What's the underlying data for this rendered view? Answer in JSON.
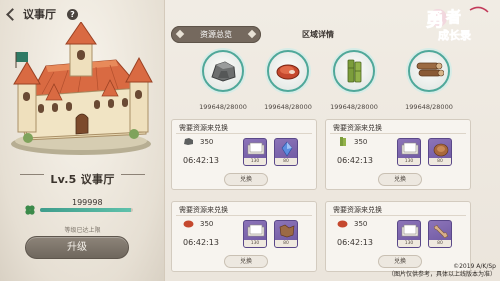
{
  "header": {
    "title": "议事厅"
  },
  "left_panel": {
    "level_label": "Lv.5 议事厅",
    "exp_value": "199998",
    "exp_fraction": 0.98,
    "max_note": "等级已达上限",
    "upgrade_label": "升级"
  },
  "tabs": {
    "overview": "资源总览",
    "detail": "区域详情"
  },
  "logo": {
    "text": "勇者成长录"
  },
  "resources": [
    {
      "name": "stone",
      "count": "199648/28000"
    },
    {
      "name": "meat",
      "count": "199648/28000"
    },
    {
      "name": "bamboo",
      "count": "199648/28000"
    },
    {
      "name": "wood",
      "count": "199648/28000"
    }
  ],
  "cards": [
    {
      "title": "需要资源来兑换",
      "resource_icon": "stone-icon",
      "amount": "350",
      "timer": "06:42:13",
      "slots": [
        {
          "icon": "paper-icon",
          "num": "130"
        },
        {
          "icon": "crystal-icon",
          "num": "80"
        }
      ],
      "button": "兑换"
    },
    {
      "title": "需要资源来兑换",
      "resource_icon": "bamboo-icon",
      "amount": "350",
      "timer": "06:42:13",
      "slots": [
        {
          "icon": "paper-icon",
          "num": "130"
        },
        {
          "icon": "leather-icon",
          "num": "80"
        }
      ],
      "button": "兑换"
    },
    {
      "title": "需要资源来兑换",
      "resource_icon": "meat-icon",
      "amount": "350",
      "timer": "06:42:13",
      "slots": [
        {
          "icon": "paper-icon",
          "num": "130"
        },
        {
          "icon": "hide-icon",
          "num": "80"
        }
      ],
      "button": "兑换"
    },
    {
      "title": "需要资源来兑换",
      "resource_icon": "meat-icon",
      "amount": "350",
      "timer": "06:42:13",
      "slots": [
        {
          "icon": "paper-icon",
          "num": "130"
        },
        {
          "icon": "bone-icon",
          "num": "80"
        }
      ],
      "button": "兑换"
    }
  ],
  "footer": {
    "copyright": "©2019 A/K/Sp",
    "disclaimer": "（图片仅供参考，具体以上线版本为准）"
  },
  "colors": {
    "accent_teal": "#4fa89a",
    "tab_active": "#75695e",
    "slot_purple": "#7a63ac"
  }
}
